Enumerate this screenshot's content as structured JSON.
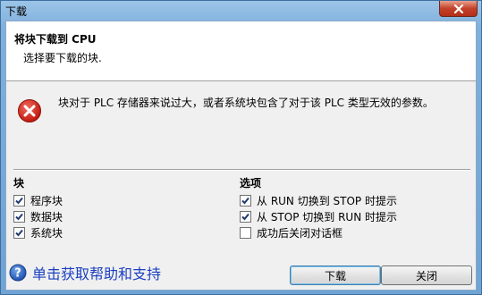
{
  "window": {
    "title": "下载"
  },
  "header": {
    "title": "将块下载到 CPU",
    "subtitle": "选择要下载的块."
  },
  "error": {
    "icon": "error-icon",
    "message": "块对于 PLC 存储器来说过大，或者系统块包含了对于该 PLC 类型无效的参数。"
  },
  "blocks": {
    "title": "块",
    "items": [
      {
        "label": "程序块",
        "checked": true
      },
      {
        "label": "数据块",
        "checked": true
      },
      {
        "label": "系统块",
        "checked": true
      }
    ]
  },
  "options": {
    "title": "选项",
    "items": [
      {
        "label": "从 RUN 切换到 STOP 时提示",
        "checked": true
      },
      {
        "label": "从 STOP 切换到 RUN 时提示",
        "checked": true
      },
      {
        "label": "成功后关闭对话框",
        "checked": false
      }
    ]
  },
  "help": {
    "icon": "help-icon",
    "label": "单击获取帮助和支持"
  },
  "buttons": {
    "download": "下载",
    "close": "关闭"
  },
  "colors": {
    "error_red": "#d9261c",
    "link_blue": "#1a3fbf",
    "help_blue": "#2060c0"
  }
}
